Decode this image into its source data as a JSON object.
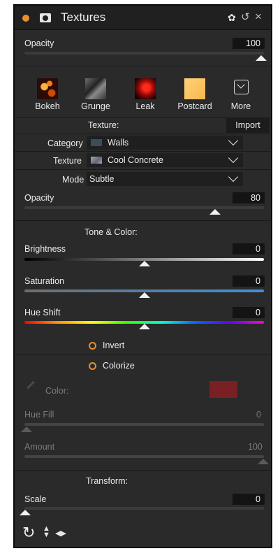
{
  "header": {
    "title": "Textures"
  },
  "top_opacity": {
    "label": "Opacity",
    "value": "100",
    "level": 1.0
  },
  "presets": [
    {
      "label": "Bokeh"
    },
    {
      "label": "Grunge"
    },
    {
      "label": "Leak"
    },
    {
      "label": "Postcard"
    },
    {
      "label": "More"
    }
  ],
  "texture_section": {
    "heading": "Texture:",
    "import_label": "Import",
    "category_label": "Category",
    "category_value": "Walls",
    "texture_label": "Texture",
    "texture_value": "Cool Concrete",
    "mode_label": "Mode",
    "mode_value": "Subtle",
    "opacity_label": "Opacity",
    "opacity_value": "80",
    "opacity_level": 0.8
  },
  "tone_section": {
    "heading": "Tone & Color:",
    "brightness_label": "Brightness",
    "brightness_value": "0",
    "saturation_label": "Saturation",
    "saturation_value": "0",
    "hue_shift_label": "Hue Shift",
    "hue_shift_value": "0",
    "invert_label": "Invert",
    "colorize_label": "Colorize",
    "color_label": "Color:",
    "color_swatch": "#7a1f24",
    "hue_fill_label": "Hue Fill",
    "hue_fill_value": "0",
    "amount_label": "Amount",
    "amount_value": "100"
  },
  "transform_section": {
    "heading": "Transform:",
    "scale_label": "Scale",
    "scale_value": "0"
  },
  "colors": {
    "accent": "#e8902c",
    "panel_bg": "#2a2a2a"
  }
}
